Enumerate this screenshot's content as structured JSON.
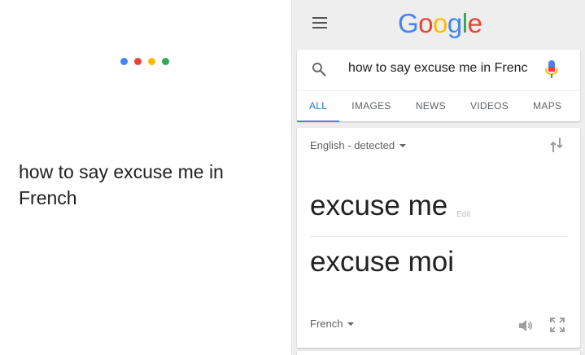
{
  "assistant": {
    "dot_colors": [
      "#4285F4",
      "#EA4335",
      "#FBBC05",
      "#34A853"
    ],
    "query_text": "how to say excuse me in French"
  },
  "results": {
    "logo": {
      "letters": [
        "G",
        "o",
        "o",
        "g",
        "l",
        "e"
      ],
      "colors": [
        "#4285F4",
        "#EA4335",
        "#FBBC05",
        "#4285F4",
        "#34A853",
        "#EA4335"
      ]
    },
    "search": {
      "value": "how to say excuse me in Frenc",
      "icon": "search-icon",
      "mic_icon": "mic-icon"
    },
    "tabs": [
      {
        "label": "ALL",
        "active": true
      },
      {
        "label": "IMAGES",
        "active": false
      },
      {
        "label": "NEWS",
        "active": false
      },
      {
        "label": "VIDEOS",
        "active": false
      },
      {
        "label": "MAPS",
        "active": false
      }
    ],
    "translate": {
      "source_lang": "English - detected",
      "source_text": "excuse me",
      "edit_label": "Edit",
      "target_text": "excuse moi",
      "target_lang": "French"
    }
  },
  "colors": {
    "accent": "#4285F4",
    "tab_active": "#1A73E8",
    "background": "#EEEEEE"
  }
}
